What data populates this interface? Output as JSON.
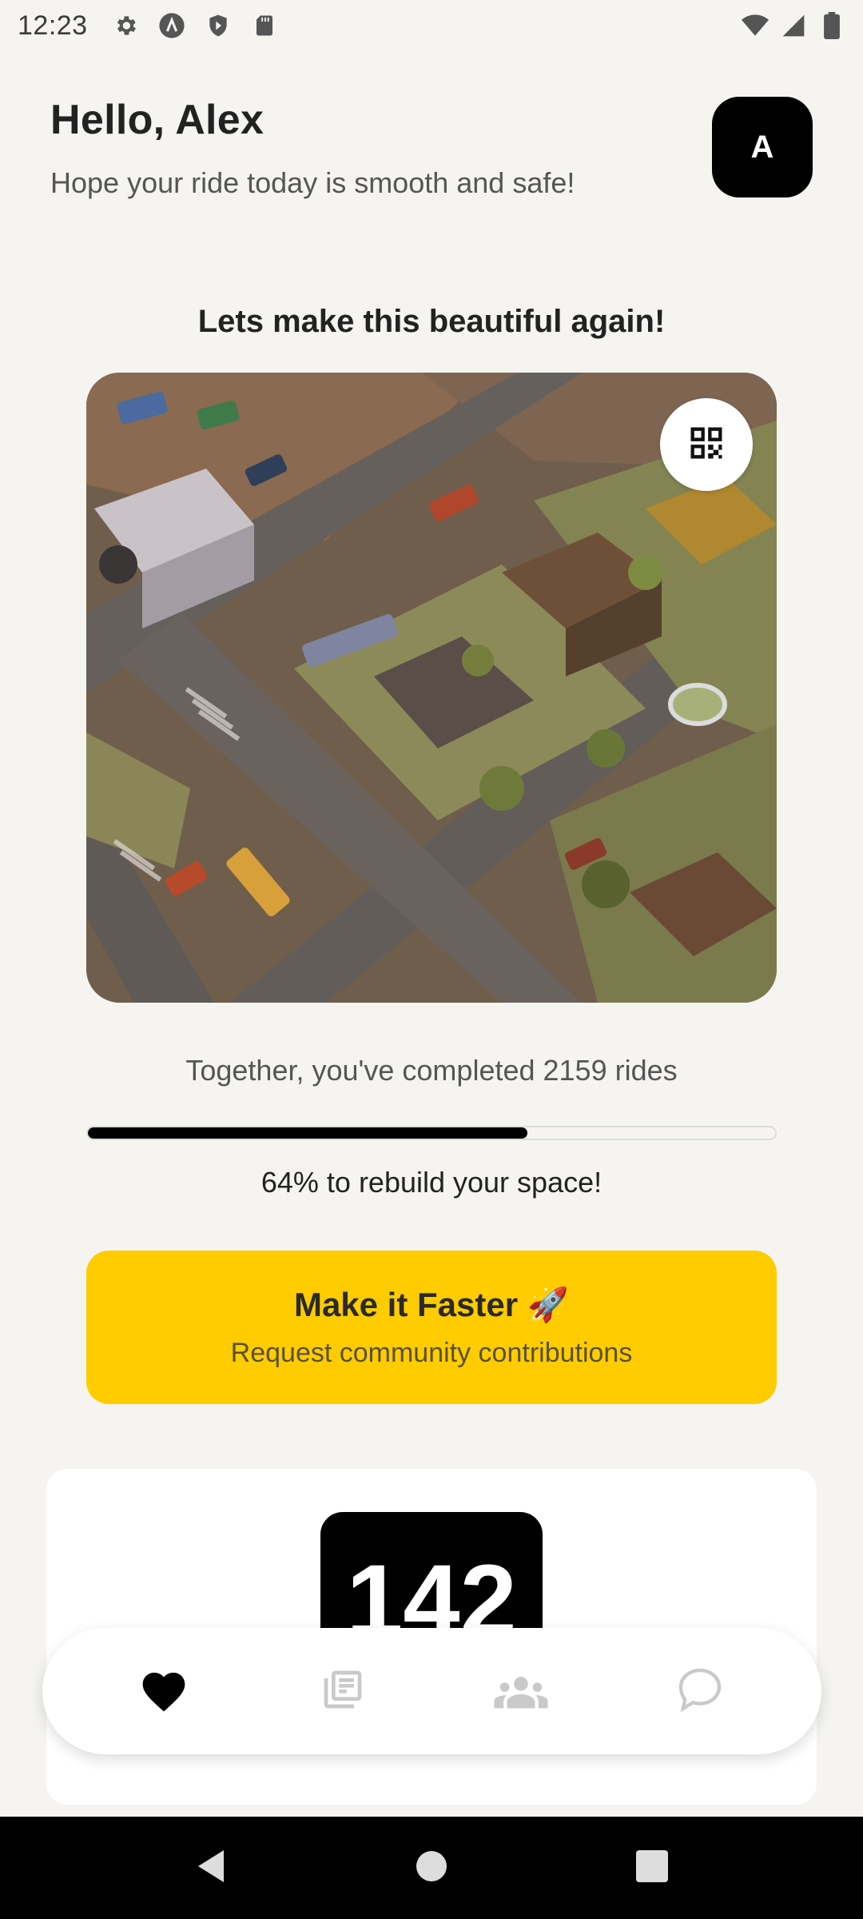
{
  "status_bar": {
    "time": "12:23",
    "left_icons": [
      "gear-icon",
      "a-circle-icon",
      "shield-play-icon",
      "sd-card-icon"
    ],
    "right_icons": [
      "wifi-icon",
      "signal-icon",
      "battery-icon"
    ]
  },
  "header": {
    "greeting": "Hello, Alex",
    "subtitle": "Hope your ride today is smooth and safe!",
    "avatar_letter": "A"
  },
  "progress_section": {
    "title": "Lets make this beautiful again!",
    "rides_text": "Together, you've completed 2159 rides",
    "progress_percent": 64,
    "progress_label": "64% to rebuild your space!"
  },
  "faster_button": {
    "title": "Make it Faster 🚀",
    "subtitle": "Request community contributions"
  },
  "stats_card": {
    "count": "142"
  },
  "bottom_nav": {
    "items": [
      {
        "icon": "heart-icon",
        "active": true
      },
      {
        "icon": "collections-icon",
        "active": false
      },
      {
        "icon": "people-icon",
        "active": false
      },
      {
        "icon": "chat-bubble-icon",
        "active": false
      }
    ]
  },
  "colors": {
    "background": "#f5f4f1",
    "accent_yellow": "#ffcc00",
    "dark": "#000000",
    "inactive_icon": "#c9c9c9"
  }
}
